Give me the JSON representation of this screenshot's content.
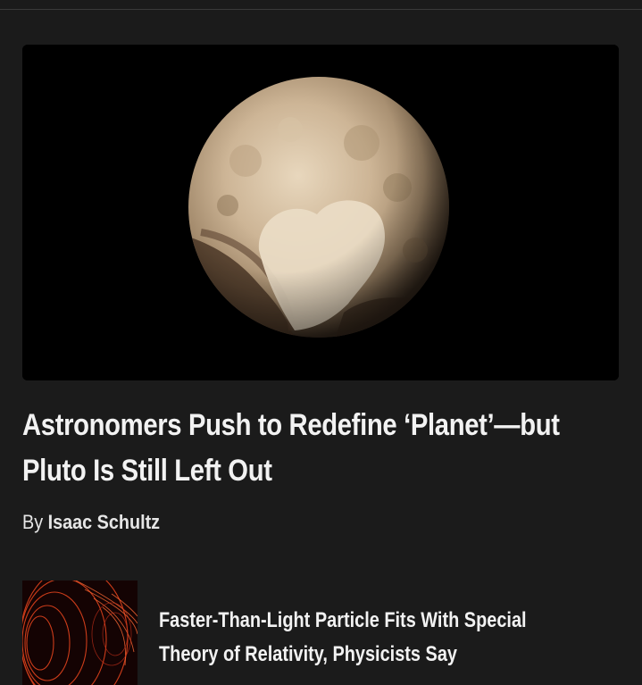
{
  "article": {
    "headline": "Astronomers Push to Redefine ‘Planet’—but Pluto Is Still Left Out",
    "byline_prefix": "By",
    "author": "Isaac Schultz",
    "hero_image": "pluto-photo"
  },
  "related": {
    "title": "Faster-Than-Light Particle Fits With Special Theory of Relativity, Physicists Say",
    "thumbnail": "red-spiral-rings-image"
  },
  "colors": {
    "background": "#1b1b1b",
    "text": "#f2f2f2",
    "hero_background": "#000000"
  }
}
